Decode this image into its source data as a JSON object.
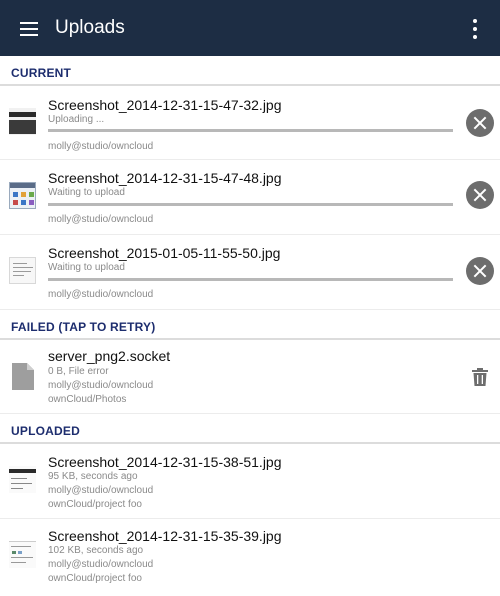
{
  "app_bar": {
    "title": "Uploads",
    "menu_icon": "hamburger-menu-icon",
    "overflow_icon": "more-vert-icon",
    "background_color": "#1d2d44"
  },
  "sections": {
    "current": {
      "label": "CURRENT"
    },
    "failed": {
      "label": "FAILED (TAP TO RETRY)"
    },
    "uploaded": {
      "label": "UPLOADED"
    }
  },
  "current_items": [
    {
      "name": "Screenshot_2014-12-31-15-47-32.jpg",
      "status": "Uploading ...",
      "account": "molly@studio/owncloud",
      "action_icon": "cancel-icon"
    },
    {
      "name": "Screenshot_2014-12-31-15-47-48.jpg",
      "status": "Waiting to upload",
      "account": "molly@studio/owncloud",
      "action_icon": "cancel-icon"
    },
    {
      "name": "Screenshot_2015-01-05-11-55-50.jpg",
      "status": "Waiting to upload",
      "account": "molly@studio/owncloud",
      "action_icon": "cancel-icon"
    }
  ],
  "failed_items": [
    {
      "name": "server_png2.socket",
      "status": "0 B, File error",
      "account": "molly@studio/owncloud",
      "path": "ownCloud/Photos",
      "action_icon": "trash-icon"
    }
  ],
  "uploaded_items": [
    {
      "name": "Screenshot_2014-12-31-15-38-51.jpg",
      "status": "95 KB,  seconds ago",
      "account": "molly@studio/owncloud",
      "path": "ownCloud/project foo"
    },
    {
      "name": "Screenshot_2014-12-31-15-35-39.jpg",
      "status": "102 KB,  seconds ago",
      "account": "molly@studio/owncloud",
      "path": "ownCloud/project foo"
    }
  ],
  "colors": {
    "section_label": "#1d2d6e",
    "progress_track": "#b8b8b8",
    "cancel_button": "#6d6d6d",
    "secondary_text": "#8a8a8a"
  }
}
